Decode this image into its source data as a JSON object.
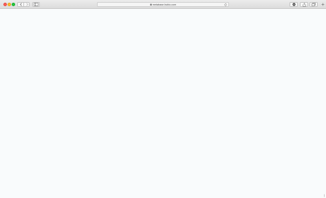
{
  "browser": {
    "address_bar": {
      "url": "metabase.hubio.com"
    }
  },
  "page": {
    "background": "#f9fbfc"
  },
  "icons": {
    "lock": "lock-icon",
    "reload": "reload-icon",
    "back": "chevron-left-icon",
    "forward": "chevron-right-icon",
    "sidebar": "sidebar-icon",
    "extension": "extension-icon",
    "share": "share-icon",
    "tabs": "tabs-icon",
    "new_tab": "plus-icon"
  }
}
